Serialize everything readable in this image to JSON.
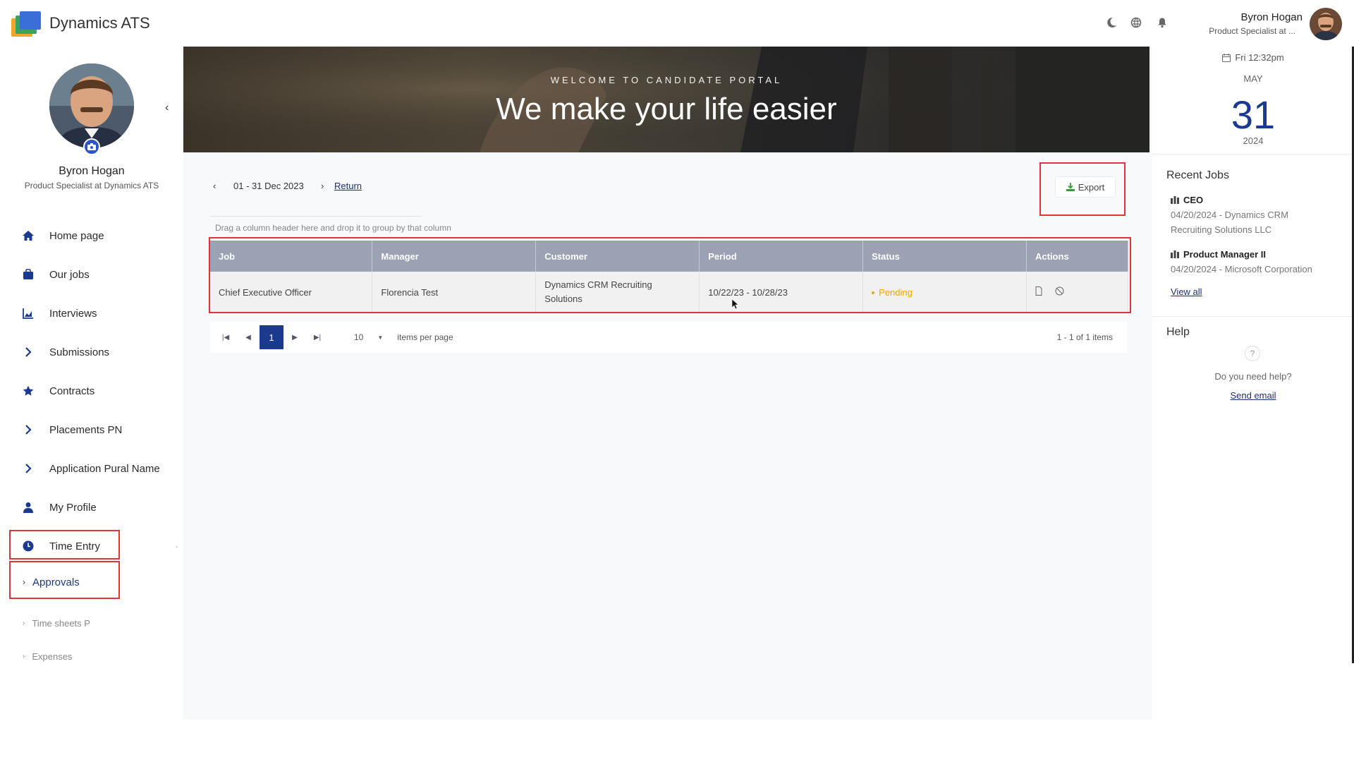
{
  "app": {
    "title": "Dynamics ATS"
  },
  "topbar": {
    "icons": [
      "moon-icon",
      "globe-icon",
      "bell-icon"
    ],
    "user_name": "Byron Hogan",
    "user_role": "Product Specialist at ..."
  },
  "sidebar": {
    "name": "Byron Hogan",
    "role": "Product Specialist at Dynamics ATS",
    "items": [
      {
        "label": "Home page",
        "icon": "home-icon"
      },
      {
        "label": "Our jobs",
        "icon": "briefcase-icon"
      },
      {
        "label": "Interviews",
        "icon": "chart-icon"
      },
      {
        "label": "Submissions",
        "icon": "chevron-right-icon"
      },
      {
        "label": "Contracts",
        "icon": "star-icon"
      },
      {
        "label": "Placements PN",
        "icon": "chevron-right-icon"
      },
      {
        "label": "Application Pural Name",
        "icon": "chevron-right-icon"
      },
      {
        "label": "My Profile",
        "icon": "user-icon"
      },
      {
        "label": "Time Entry",
        "icon": "clock-icon"
      }
    ],
    "approvals": "Approvals",
    "sub_items": [
      {
        "label": "Time sheets P"
      },
      {
        "label": "Expenses"
      }
    ]
  },
  "banner": {
    "subtitle": "WELCOME TO CANDIDATE PORTAL",
    "title": "We make your life easier"
  },
  "main": {
    "period": "01 - 31 Dec 2023",
    "return_label": "Return",
    "export_label": "Export",
    "drag_hint": "Drag a column header here and drop it to group by that column",
    "columns": [
      "Job",
      "Manager",
      "Customer",
      "Period",
      "Status",
      "Actions"
    ],
    "rows": [
      {
        "job": "Chief Executive Officer",
        "manager": "Florencia Test",
        "customer": "Dynamics CRM Recruiting Solutions",
        "period": "10/22/23 - 10/28/23",
        "status": "Pending"
      }
    ],
    "pager": {
      "current_page": "1",
      "page_size": "10",
      "page_size_label": "items per page",
      "summary": "1 - 1 of 1 items"
    }
  },
  "rightpanel": {
    "clock": "Fri 12:32pm",
    "month": "MAY",
    "day": "31",
    "year": "2024",
    "recent_jobs_title": "Recent Jobs",
    "jobs": [
      {
        "title": "CEO",
        "line1": "04/20/2024 - Dynamics CRM",
        "line2": "Recruiting Solutions LLC"
      },
      {
        "title": "Product Manager II",
        "line1": "04/20/2024 - Microsoft Corporation",
        "line2": ""
      }
    ],
    "view_all": "View all",
    "help_title": "Help",
    "help_question": "Do you need help?",
    "help_link": "Send email"
  },
  "colors": {
    "accent": "#1a3a8f",
    "header_bg": "#9aa2b3",
    "pending": "#f0a500",
    "highlight": "#e0343b"
  }
}
